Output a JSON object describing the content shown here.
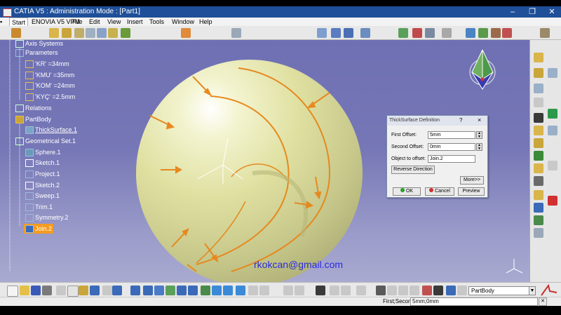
{
  "window": {
    "title": "CATIA V5 : Administration Mode : [Part1]"
  },
  "menu": [
    "Start",
    "ENOVIA V5 VPM",
    "File",
    "Edit",
    "View",
    "Insert",
    "Tools",
    "Window",
    "Help"
  ],
  "tree": {
    "axis": "Axis Systems",
    "parameters": "Parameters",
    "params": [
      "'KR' =34mm",
      "'KMU' =35mm",
      "'KOM' =24mm",
      "'KYÇ' =2.5mm"
    ],
    "relations": "Relations",
    "partbody": "PartBody",
    "thick": "ThickSurface.1",
    "geoset": "Geometrical Set.1",
    "geo_items": [
      "Sphere.1",
      "Sketch.1",
      "Project.1",
      "Sketch.2",
      "Sweep.1",
      "Trim.1",
      "Symmetry.2",
      "Join.2"
    ]
  },
  "dialog": {
    "title": "ThickSurface Definition",
    "help": "?",
    "close": "×",
    "first_label": "First Offset:",
    "first_value": "5mm",
    "second_label": "Second Offset:",
    "second_value": "0mm",
    "object_label": "Object to offset:",
    "object_value": "Join.2",
    "reverse": "Reverse Direction",
    "more": "More>>",
    "ok": "OK",
    "cancel": "Cancel",
    "preview": "Preview"
  },
  "watermark": "rkokcan@gmail.com",
  "bottom": {
    "combo_value": "PartBody"
  },
  "status": {
    "text": "First;Second",
    "value": "5mm;0mm"
  }
}
